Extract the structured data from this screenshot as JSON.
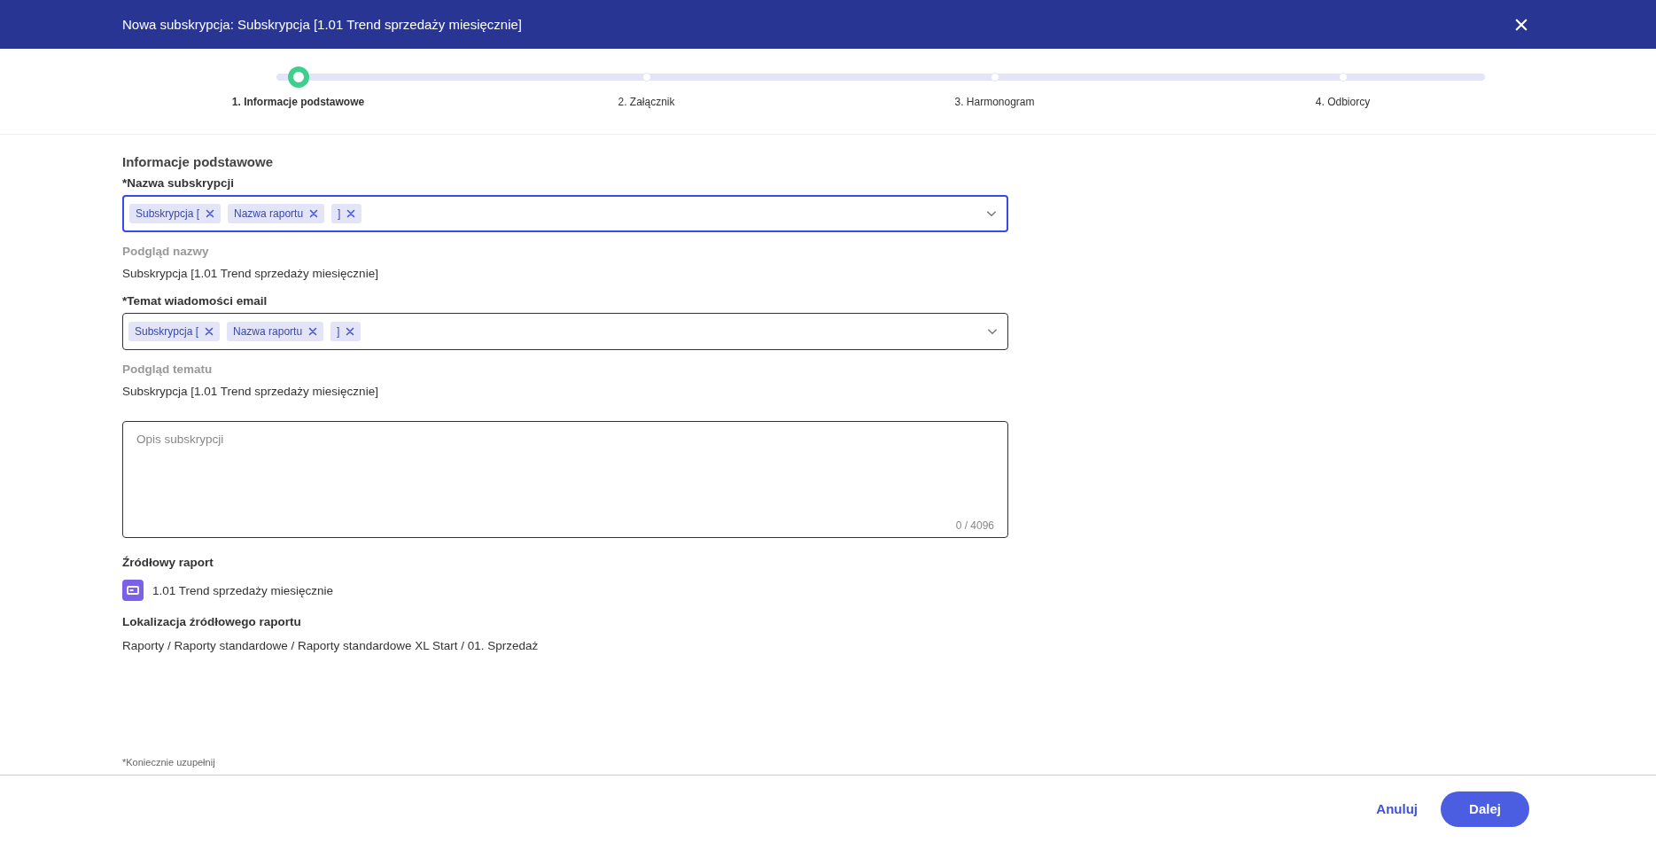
{
  "window": {
    "title": "Nowa subskrypcja: Subskrypcja [1.01 Trend sprzedaży miesięcznie]"
  },
  "steps": [
    {
      "label": "1. Informacje podstawowe",
      "selected": true
    },
    {
      "label": "2. Załącznik",
      "selected": false
    },
    {
      "label": "3. Harmonogram",
      "selected": false
    },
    {
      "label": "4. Odbiorcy",
      "selected": false
    }
  ],
  "section_title": "Informacje podstawowe",
  "fields": [
    {
      "label": "*Nazwa subskrypcji",
      "focused": true,
      "tokens": [
        "Subskrypcja [",
        "Nazwa raportu",
        "]"
      ],
      "preview_label": "Podgląd nazwy",
      "preview": "Subskrypcja [1.01 Trend sprzedaży miesięcznie]"
    },
    {
      "label": "*Temat wiadomości email",
      "focused": false,
      "tokens": [
        "Subskrypcja [",
        "Nazwa raportu",
        "]"
      ],
      "preview_label": "Podgląd tematu",
      "preview": "Subskrypcja [1.01 Trend sprzedaży miesięcznie]"
    }
  ],
  "description": {
    "placeholder": "Opis subskrypcji",
    "counter": "0 / 4096"
  },
  "source_report": {
    "label": "Źródłowy raport",
    "name": "1.01 Trend sprzedaży miesięcznie"
  },
  "location": {
    "label": "Lokalizacja źródłowego raportu",
    "path": "Raporty / Raporty standardowe / Raporty standardowe XL Start / 01. Sprzedaż"
  },
  "required_note": "*Koniecznie uzupełnij",
  "buttons": {
    "cancel": "Anuluj",
    "next": "Dalej"
  }
}
